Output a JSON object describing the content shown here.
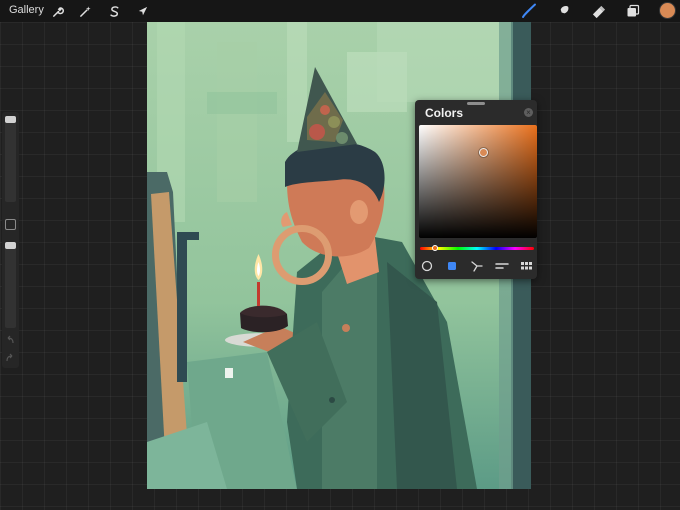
{
  "topbar": {
    "gallery_label": "Gallery",
    "tools_left": [
      {
        "icon": "wrench-icon",
        "name": "actions-button"
      },
      {
        "icon": "magic-wand-icon",
        "name": "adjustments-button"
      },
      {
        "icon": "selection-s-icon",
        "name": "selection-button"
      },
      {
        "icon": "arrow-cursor-icon",
        "name": "transform-button"
      }
    ],
    "tools_right": [
      {
        "icon": "brush-icon",
        "name": "paint-tool-button",
        "active": true
      },
      {
        "icon": "smudge-finger-icon",
        "name": "smudge-tool-button"
      },
      {
        "icon": "eraser-icon",
        "name": "eraser-tool-button"
      },
      {
        "icon": "layers-icon",
        "name": "layers-button"
      }
    ],
    "active_color": "#d98a55",
    "accent_color": "#3f87f5"
  },
  "sidebar": {
    "size_slider_value": 0.0,
    "opacity_slider_value": 0.0,
    "modify_icon": "square-modify-icon",
    "undo_icon": "undo-arrow-icon",
    "redo_icon": "redo-arrow-icon"
  },
  "canvas": {
    "subject": "painting-man-party-hat-cake"
  },
  "colors_panel": {
    "title": "Colors",
    "close_icon": "close-x-icon",
    "hue_color": "#e9701c",
    "selected_color": "#d98a55",
    "saturation": 0.55,
    "brightness": 0.75,
    "hue_position": 0.13,
    "modes": [
      {
        "icon": "disc-mode-icon",
        "active": false
      },
      {
        "icon": "classic-mode-icon",
        "active": true
      },
      {
        "icon": "harmony-mode-icon",
        "active": false
      },
      {
        "icon": "value-mode-icon",
        "active": false
      },
      {
        "icon": "palettes-mode-icon",
        "active": false
      }
    ]
  },
  "brush_cursor_color": "#dd9c71"
}
